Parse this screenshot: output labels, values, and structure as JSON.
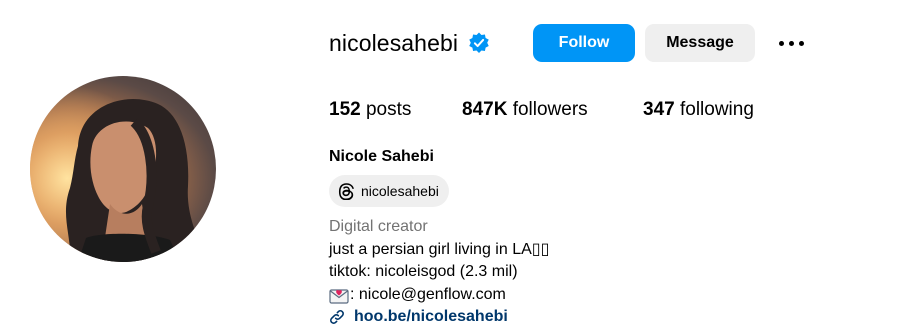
{
  "profile": {
    "username": "nicolesahebi",
    "verified": true,
    "follow_label": "Follow",
    "message_label": "Message",
    "more_icon": "more-options-icon",
    "avatar_icon": "profile-photo"
  },
  "stats": {
    "posts_count": "152",
    "posts_label": "posts",
    "followers_count": "847K",
    "followers_label": "followers",
    "following_count": "347",
    "following_label": "following"
  },
  "bio": {
    "full_name": "Nicole Sahebi",
    "threads_handle": "nicolesahebi",
    "category": "Digital creator",
    "line1": "just a persian girl living in LA▯▯",
    "line2": "tiktok: nicoleisgod (2.3 mil)",
    "line3": ": nicole@genflow.com",
    "link": "hoo.be/nicolesahebi"
  },
  "colors": {
    "follow_bg": "#0095f6",
    "verified_badge": "#0095f6",
    "secondary_bg": "#efefef",
    "category_text": "#737373",
    "link_text": "#00376b"
  }
}
